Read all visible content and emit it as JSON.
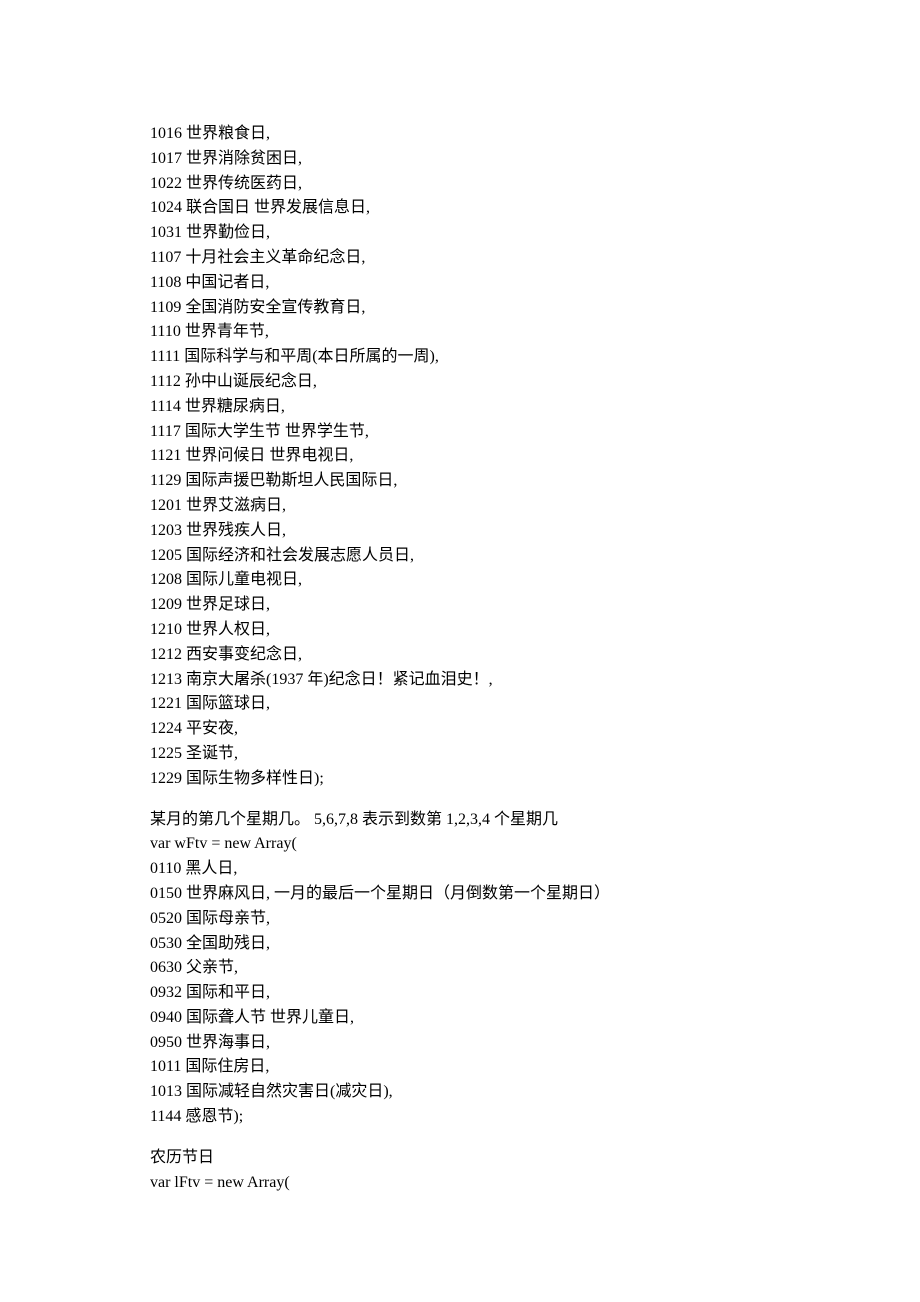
{
  "lines": [
    "1016 世界粮食日,",
    "1017 世界消除贫困日,",
    "1022 世界传统医药日,",
    "1024 联合国日 世界发展信息日,",
    "1031 世界勤俭日,",
    "1107 十月社会主义革命纪念日,",
    "1108 中国记者日,",
    "1109 全国消防安全宣传教育日,",
    "1110 世界青年节,",
    "1111 国际科学与和平周(本日所属的一周),",
    "1112 孙中山诞辰纪念日,",
    "1114 世界糖尿病日,",
    "1117 国际大学生节 世界学生节,",
    "1121 世界问候日 世界电视日,",
    "1129 国际声援巴勒斯坦人民国际日,",
    "1201 世界艾滋病日,",
    "1203 世界残疾人日,",
    "1205 国际经济和社会发展志愿人员日,",
    "1208 国际儿童电视日,",
    "1209 世界足球日,",
    "1210 世界人权日,",
    "1212 西安事变纪念日,",
    "1213 南京大屠杀(1937 年)纪念日！紧记血泪史！,",
    "1221 国际篮球日,",
    "1224 平安夜,",
    "1225 圣诞节,",
    "1229 国际生物多样性日);",
    "",
    "某月的第几个星期几。 5,6,7,8 表示到数第 1,2,3,4 个星期几",
    "var wFtv = new Array(",
    "0110 黑人日,",
    "0150 世界麻风日, 一月的最后一个星期日（月倒数第一个星期日）",
    "0520 国际母亲节,",
    "0530 全国助残日,",
    "0630 父亲节,",
    "0932 国际和平日,",
    "0940 国际聋人节 世界儿童日,",
    "0950 世界海事日,",
    "1011 国际住房日,",
    "1013 国际减轻自然灾害日(减灾日),",
    "1144 感恩节);",
    "",
    "农历节日",
    "var lFtv = new Array("
  ]
}
